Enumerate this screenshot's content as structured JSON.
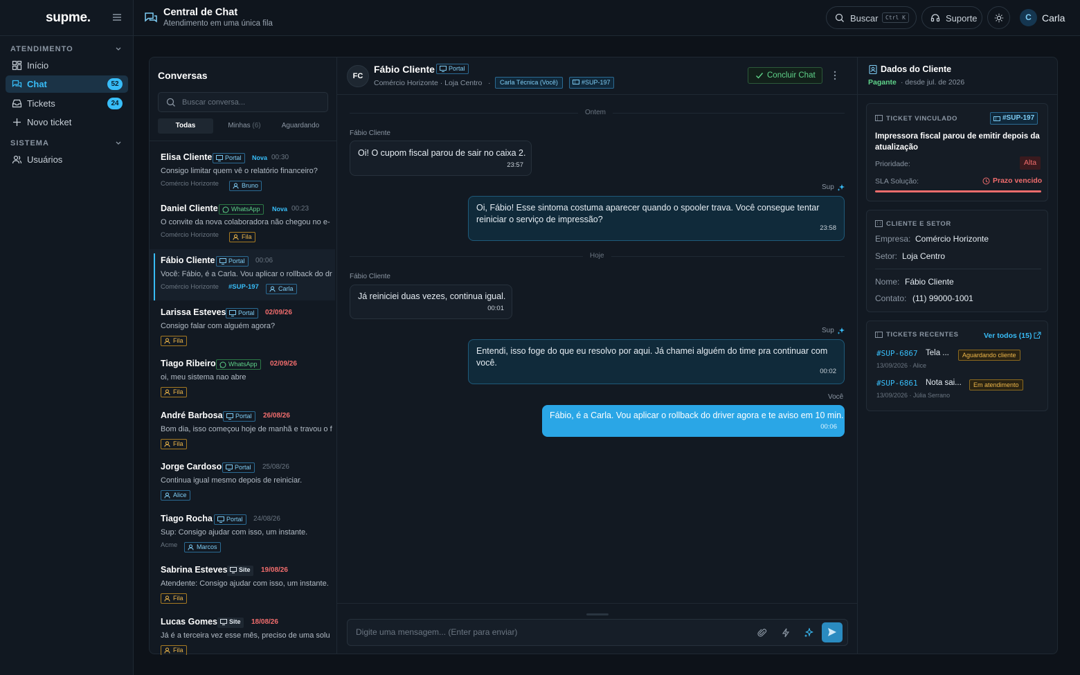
{
  "sidebar": {
    "logo": "supme.",
    "section_atendimento": "ATENDIMENTO",
    "section_sistema": "SISTEMA",
    "items": [
      {
        "label": "Início"
      },
      {
        "label": "Chat",
        "badge": "52"
      },
      {
        "label": "Tickets",
        "badge": "24"
      },
      {
        "label": "Novo ticket"
      },
      {
        "label": "Usuários"
      }
    ]
  },
  "header": {
    "title": "Central de Chat",
    "subtitle": "Atendimento em uma única fila",
    "search_label": "Buscar",
    "search_kbd": "Ctrl K",
    "support_label": "Suporte",
    "user_initial": "C",
    "user_name": "Carla"
  },
  "conversations": {
    "title": "Conversas",
    "search_placeholder": "Buscar conversa...",
    "tabs": [
      {
        "label": "Todas"
      },
      {
        "label": "Minhas",
        "count": "(6)"
      },
      {
        "label": "Aguardando"
      }
    ],
    "items": [
      {
        "name": "Elisa Cliente",
        "channel": "Portal",
        "new": "Nova",
        "time": "00:30",
        "preview": "Consigo limitar quem vê o relatório financeiro?",
        "company": "Comércio Horizonte",
        "assignee": "Bruno"
      },
      {
        "name": "Daniel Cliente",
        "channel": "WhatsApp",
        "new": "Nova",
        "time": "00:23",
        "preview": "O convite da nova colaboradora não chegou no e-",
        "company": "Comércio Horizonte",
        "assignee": "Fila"
      },
      {
        "name": "Fábio Cliente",
        "channel": "Portal",
        "time": "00:06",
        "preview": "Você: Fábio, é a Carla. Vou aplicar o rollback do dr",
        "company": "Comércio Horizonte",
        "ticket": "#SUP-197",
        "assignee": "Carla"
      },
      {
        "name": "Larissa Esteves",
        "channel": "Portal",
        "time": "02/09/26",
        "preview": "Consigo falar com alguém agora?",
        "assignee": "Fila"
      },
      {
        "name": "Tiago Ribeiro",
        "channel": "WhatsApp",
        "time": "02/09/26",
        "preview": "oi, meu sistema nao abre",
        "assignee": "Fila"
      },
      {
        "name": "André Barbosa",
        "channel": "Portal",
        "time": "26/08/26",
        "preview": "Bom dia, isso começou hoje de manhã e travou o f",
        "assignee": "Fila"
      },
      {
        "name": "Jorge Cardoso",
        "channel": "Portal",
        "time": "25/08/26",
        "preview": "Continua igual mesmo depois de reiniciar.",
        "assignee": "Alice"
      },
      {
        "name": "Tiago Rocha",
        "channel": "Portal",
        "time": "24/08/26",
        "preview": "Sup: Consigo ajudar com isso, um instante.",
        "company": "Acme",
        "assignee": "Marcos"
      },
      {
        "name": "Sabrina Esteves",
        "channel": "Site",
        "time": "19/08/26",
        "preview": "Atendente: Consigo ajudar com isso, um instante.",
        "assignee": "Fila"
      },
      {
        "name": "Lucas Gomes",
        "channel": "Site",
        "time": "18/08/26",
        "preview": "Já é a terceira vez esse mês, preciso de uma solu",
        "assignee": "Fila"
      }
    ]
  },
  "chat": {
    "avatar": "FC",
    "name": "Fábio Cliente",
    "channel": "Portal",
    "location": "Comércio Horizonte · Loja Centro",
    "dot": "·",
    "agent_tag": "Carla Técnica (Você)",
    "ticket_tag": "#SUP-197",
    "conclude_label": "Concluir Chat",
    "day1": "Ontem",
    "day2": "Hoje",
    "messages": [
      {
        "sender": "Fábio Cliente",
        "text": "Oi! O cupom fiscal parou de sair no caixa 2.",
        "time": "23:57"
      },
      {
        "sender": "Sup",
        "text": "Oi, Fábio! Esse sintoma costuma aparecer quando o spooler trava. Você consegue tentar reiniciar o serviço de impressão?",
        "time": "23:58"
      },
      {
        "sender": "Fábio Cliente",
        "text": "Já reiniciei duas vezes, continua igual.",
        "time": "00:01"
      },
      {
        "sender": "Sup",
        "text": "Entendi, isso foge do que eu resolvo por aqui. Já chamei alguém do time pra continuar com você.",
        "time": "00:02"
      },
      {
        "sender": "Você",
        "text": "Fábio, é a Carla. Vou aplicar o rollback do driver agora e te aviso em 10 min.",
        "time": "00:06"
      }
    ],
    "input_placeholder": "Digite uma mensagem... (Enter para enviar)"
  },
  "client": {
    "title": "Dados do Cliente",
    "plan": "Pagante",
    "since": "· desde jul. de 2026",
    "ticket_card": {
      "heading": "TICKET VINCULADO",
      "ticket": "#SUP-197",
      "title": "Impressora fiscal parou de emitir depois da atualização",
      "priority_label": "Prioridade:",
      "priority": "Alta",
      "sla_label": "SLA Solução:",
      "sla": "Prazo vencido",
      "sla_progress": 1.0
    },
    "client_card": {
      "heading": "CLIENTE E SETOR",
      "company_label": "Empresa:",
      "company": "Comércio Horizonte",
      "sector_label": "Setor:",
      "sector": "Loja Centro",
      "name_label": "Nome:",
      "name": "Fábio Cliente",
      "contact_label": "Contato:",
      "contact": "(11) 99000-1001"
    },
    "recent_card": {
      "heading": "TICKETS RECENTES",
      "view_all": "Ver todos (15)",
      "items": [
        {
          "id": "#SUP-6867",
          "title": "Tela ...",
          "meta": "13/09/2026 · Alice",
          "status": "Aguardando cliente"
        },
        {
          "id": "#SUP-6861",
          "title": "Nota sai...",
          "meta": "13/09/2026 · Júlia Serrano",
          "status": "Em atendimento"
        }
      ]
    }
  },
  "colors": {
    "accent": "#38bdf8",
    "background": "#0d1219",
    "panel": "#121922",
    "danger": "#f26d6d",
    "warning": "#f0b84a",
    "success": "#5fd38a"
  }
}
